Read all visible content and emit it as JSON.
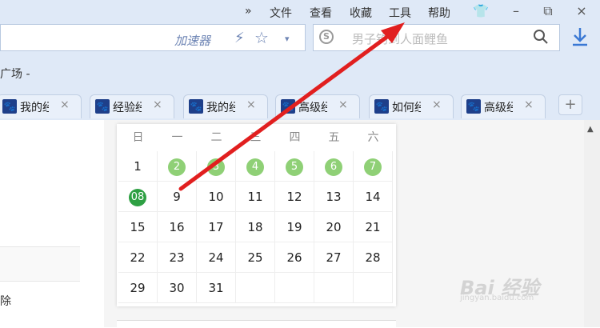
{
  "menu": {
    "more": "»",
    "file": "文件",
    "view": "查看",
    "favorites": "收藏",
    "tools": "工具",
    "help": "帮助"
  },
  "window_controls": {
    "skin": "👕",
    "minimize": "–",
    "restore": "⧉",
    "close": "×"
  },
  "address": {
    "accelerator_label": "加速器",
    "bolt": "⚡",
    "star": "☆",
    "dropdown": "▾"
  },
  "search": {
    "engine_icon": "S",
    "placeholder": "男子钓到人面鲤鱼",
    "magnifier": "🔍",
    "download": "⤓"
  },
  "bookmarks": {
    "item": "广场 -"
  },
  "tabs": [
    {
      "icon": "🐾",
      "label": "我的经",
      "close": "×"
    },
    {
      "icon": "🐾",
      "label": "经验经",
      "close": "×"
    },
    {
      "icon": "🐾",
      "label": "我的经",
      "close": "×"
    },
    {
      "icon": "🐾",
      "label": "高级经",
      "close": "×"
    },
    {
      "icon": "🐾",
      "label": "如何经",
      "close": "×"
    },
    {
      "icon": "🐾",
      "label": "高级经",
      "close": "×"
    }
  ],
  "new_tab": "+",
  "left_panel": {
    "text": "除"
  },
  "calendar": {
    "weekdays": [
      "日",
      "一",
      "二",
      "三",
      "四",
      "五",
      "六"
    ],
    "rows": [
      [
        "1",
        "2",
        "3",
        "4",
        "5",
        "6",
        "7"
      ],
      [
        "08",
        "9",
        "10",
        "11",
        "12",
        "13",
        "14"
      ],
      [
        "15",
        "16",
        "17",
        "18",
        "19",
        "20",
        "21"
      ],
      [
        "22",
        "23",
        "24",
        "25",
        "26",
        "27",
        "28"
      ],
      [
        "29",
        "30",
        "31",
        "",
        "",
        "",
        ""
      ]
    ],
    "highlighted_light": [
      "2",
      "3",
      "4",
      "5",
      "6",
      "7"
    ],
    "today": "08",
    "colors": {
      "light": "#8fd076",
      "today": "#2ea043"
    }
  },
  "annotation_arrow_color": "#e11f1f",
  "watermark": {
    "logo": "Bai 经验",
    "url": "jingyan.baidu.com"
  },
  "scroll_up": "▲"
}
